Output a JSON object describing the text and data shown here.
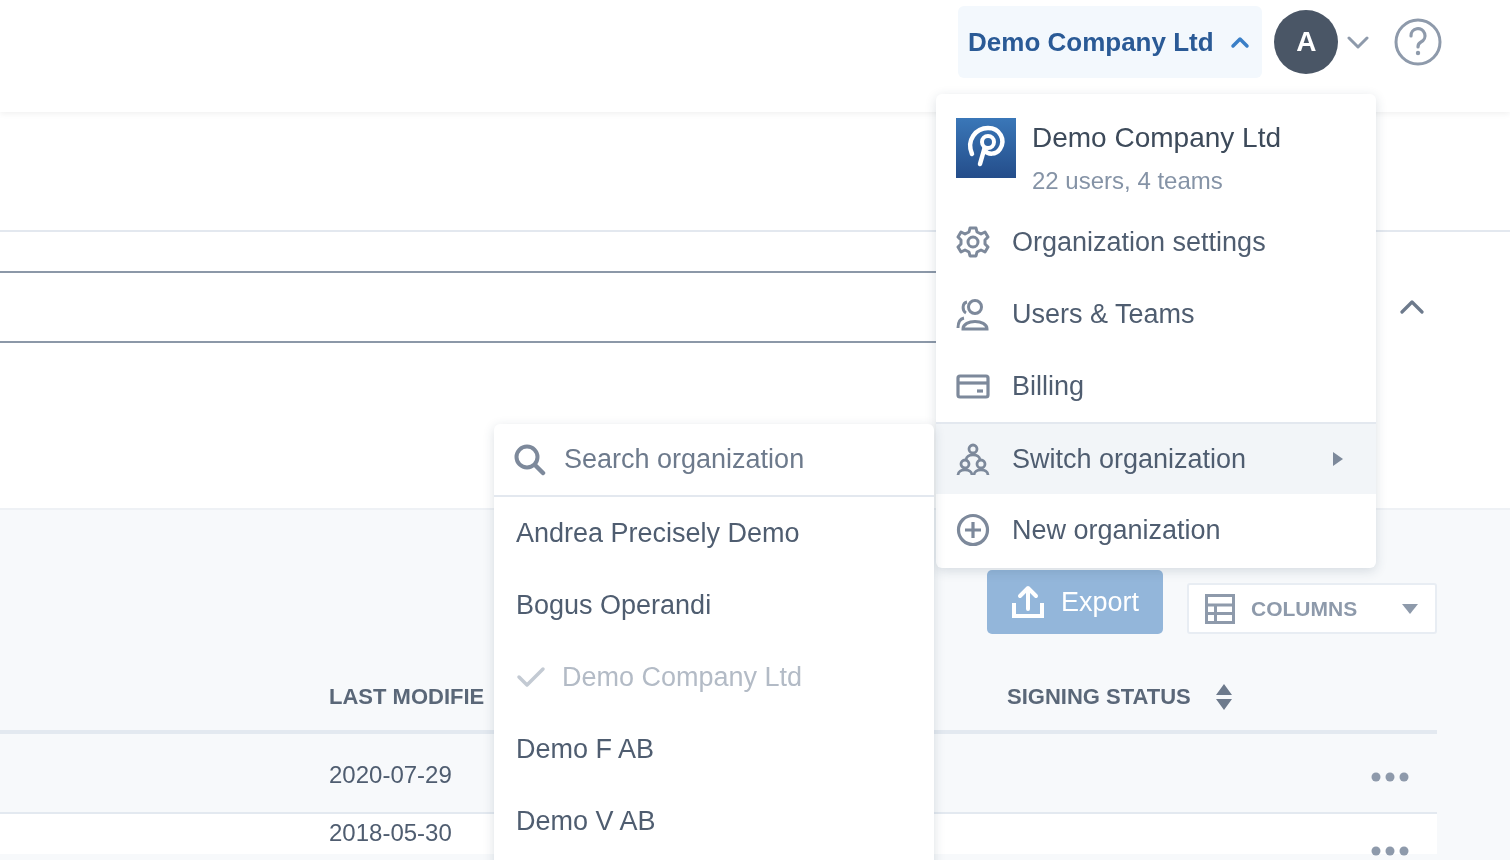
{
  "topbar": {
    "org_button": {
      "label": "Demo Company Ltd",
      "expanded": true
    },
    "avatar": {
      "initial": "A"
    }
  },
  "section": {
    "expanded": true
  },
  "toolbar": {
    "export_label": "Export",
    "columns_label": "COLUMNS"
  },
  "table": {
    "columns": [
      {
        "label": "LAST MODIFIE"
      },
      {
        "label": "SIGNING STATUS",
        "sortable": true
      }
    ],
    "rows": [
      {
        "last_modified": "2020-07-29"
      },
      {
        "last_modified": "2018-05-30"
      }
    ]
  },
  "org_menu": {
    "name": "Demo Company Ltd",
    "summary": "22 users, 4 teams",
    "items": [
      {
        "kind": "settings",
        "label": "Organization settings",
        "highlighted": false,
        "has_submenu": false
      },
      {
        "kind": "users",
        "label": "Users & Teams",
        "highlighted": false,
        "has_submenu": false
      },
      {
        "kind": "billing",
        "label": "Billing",
        "highlighted": false,
        "has_submenu": false
      },
      {
        "kind": "switch",
        "label": "Switch organization",
        "highlighted": true,
        "has_submenu": true
      },
      {
        "kind": "new",
        "label": "New organization",
        "highlighted": false,
        "has_submenu": false
      }
    ]
  },
  "switch_menu": {
    "search_placeholder": "Search organization",
    "organizations": [
      {
        "name": "Andrea Precisely Demo",
        "selected": false
      },
      {
        "name": "Bogus Operandi",
        "selected": false
      },
      {
        "name": "Demo Company Ltd",
        "selected": true
      },
      {
        "name": "Demo F AB",
        "selected": false
      },
      {
        "name": "Demo V AB",
        "selected": false
      }
    ]
  }
}
